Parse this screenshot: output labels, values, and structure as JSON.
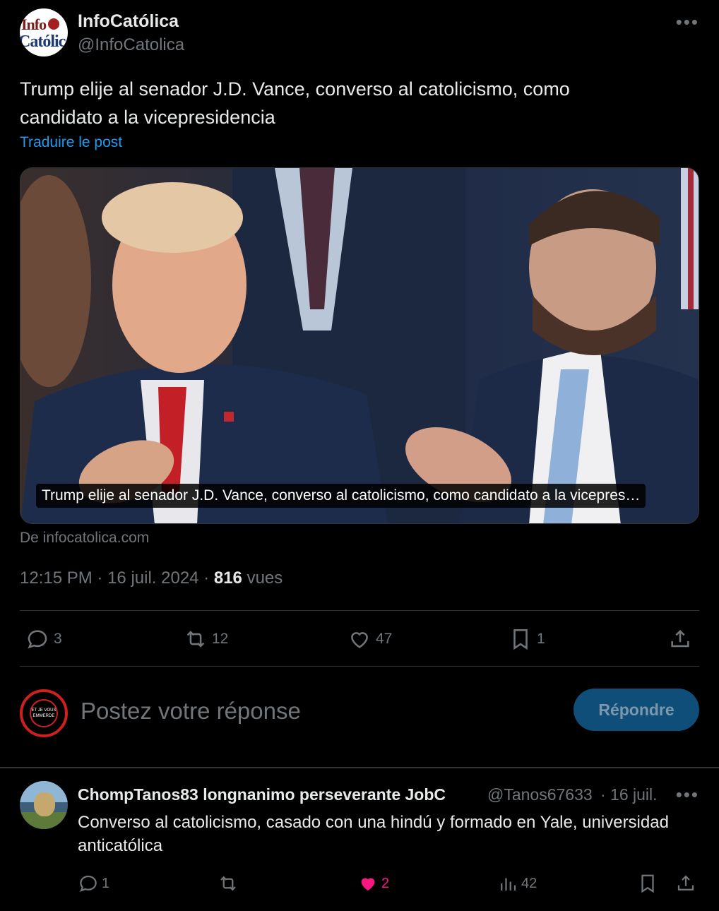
{
  "post": {
    "display_name": "InfoCatólica",
    "handle": "@InfoCatolica",
    "avatar_text_1": "Info",
    "avatar_text_2": "Católica",
    "text": "Trump elije al senador J.D. Vance, converso al catolicismo, como candidato a la vicepresidencia",
    "translate_label": "Traduire le post",
    "media_caption": "Trump elije al senador J.D. Vance, converso al catolicismo, como candidato a la vicepres…",
    "source": "De infocatolica.com",
    "time": "12:15 PM",
    "date": "16 juil. 2024",
    "views_count": "816",
    "views_label": "vues",
    "more_icon": "more-horizontal-icon"
  },
  "actions": {
    "replies": "3",
    "reposts": "12",
    "likes": "47",
    "bookmarks": "1"
  },
  "reply_box": {
    "placeholder": "Postez votre réponse",
    "button_label": "Répondre",
    "avatar_text": "ET JE VOUS EMMERDE"
  },
  "reply": {
    "display_name": "ChompTanos83 longnanimo perseverante JobC",
    "handle": "@Tanos67633",
    "date": "· 16 juil.",
    "text": "Converso al catolicismo, casado con una hindú y formado en Yale, universidad anticatólica",
    "replies": "1",
    "reposts": "",
    "likes": "2",
    "views": "42"
  },
  "colors": {
    "background": "#000000",
    "text": "#e7e9ea",
    "secondary": "#71767b",
    "link": "#1d9bf0",
    "like": "#f91880",
    "border": "#2f3336"
  }
}
